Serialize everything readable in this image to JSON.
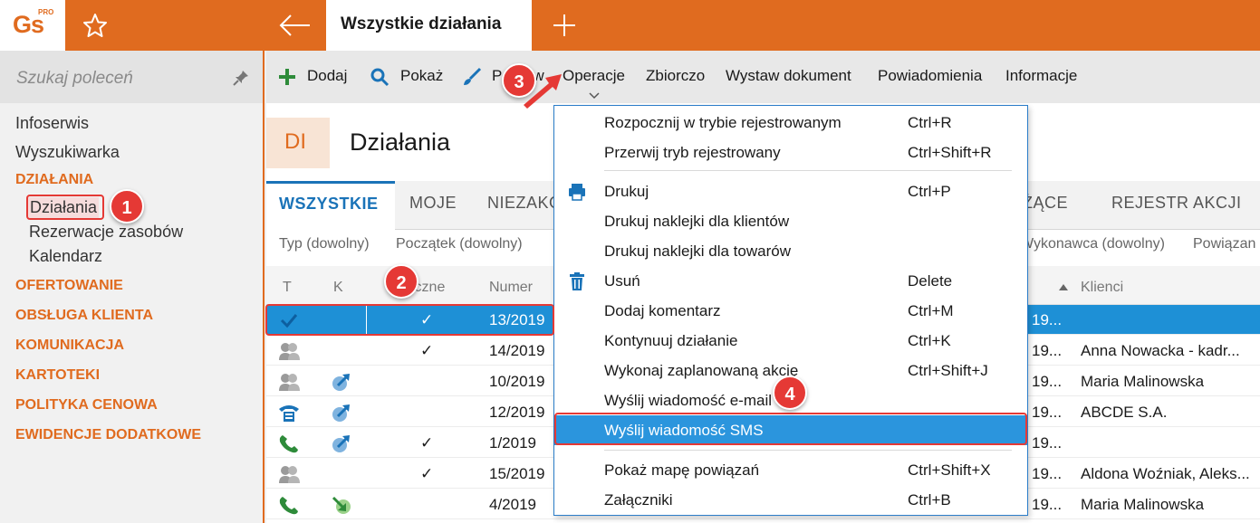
{
  "app": {
    "logo_text": "Gs",
    "logo_pro": "PRO",
    "active_tab": "Wszystkie działania",
    "accent_color": "#e06b1f",
    "selection_color": "#1e90d6"
  },
  "sidebar": {
    "search_placeholder": "Szukaj poleceń",
    "items": [
      {
        "label": "Infoserwis"
      },
      {
        "label": "Wyszukiwarka"
      }
    ],
    "section_dzialania": "DZIAŁANIA",
    "sub_items": [
      {
        "label": "Działania"
      },
      {
        "label": "Rezerwacje zasobów"
      },
      {
        "label": "Kalendarz"
      }
    ],
    "sections": [
      {
        "label": "OFERTOWANIE"
      },
      {
        "label": "OBSŁUGA KLIENTA"
      },
      {
        "label": "KOMUNIKACJA"
      },
      {
        "label": "KARTOTEKI"
      },
      {
        "label": "POLITYKA CENOWA"
      },
      {
        "label": "EWIDENCJE DODATKOWE"
      }
    ]
  },
  "toolbar": {
    "add": "Dodaj",
    "show": "Pokaż",
    "edit": "Popraw",
    "operations": "Operacje",
    "summary": "Zbiorczo",
    "issue_doc": "Wystaw dokument",
    "relations": "Powiadomienia",
    "info": "Informacje"
  },
  "page": {
    "badge": "DI",
    "title": "Działania"
  },
  "subtabs": {
    "all": "WSZYSTKIE",
    "mine": "MOJE",
    "incomplete": "NIEZAKO",
    "current": "ŻĄCE",
    "registry": "REJESTR AKCJI"
  },
  "filters": {
    "type": "Typ (dowolny)",
    "start": "Początek (dowolny)",
    "executor": "Wykonawca (dowolny)",
    "related": "Powiązan"
  },
  "columns": {
    "t": "T",
    "k": "K",
    "public": "iczne",
    "number": "Numer",
    "clients": "Klienci"
  },
  "rows": [
    {
      "number": "13/2019",
      "check": "✓",
      "date": "19...",
      "client": "",
      "type_icon": "check-icon",
      "k_icon": ""
    },
    {
      "number": "14/2019",
      "check": "✓",
      "date": "19...",
      "client": "Anna Nowacka - kadr...",
      "type_icon": "group-icon",
      "k_icon": ""
    },
    {
      "number": "10/2019",
      "check": "",
      "date": "19...",
      "client": "Maria Malinowska",
      "type_icon": "group-icon",
      "k_icon": "outgoing-arrow-icon"
    },
    {
      "number": "12/2019",
      "check": "",
      "date": "19...",
      "client": "ABCDE S.A.",
      "type_icon": "fax-icon",
      "k_icon": "outgoing-arrow-icon"
    },
    {
      "number": "1/2019",
      "check": "✓",
      "date": "19...",
      "client": "",
      "type_icon": "phone-icon",
      "k_icon": "outgoing-arrow-icon"
    },
    {
      "number": "15/2019",
      "check": "✓",
      "date": "19...",
      "client": "Aldona Woźniak, Aleks...",
      "type_icon": "group-icon",
      "k_icon": ""
    },
    {
      "number": "4/2019",
      "check": "",
      "date": "19...",
      "client": "Maria Malinowska",
      "type_icon": "phone-icon",
      "k_icon": "incoming-arrow-icon"
    }
  ],
  "menu": {
    "items": [
      {
        "label": "Rozpocznij w trybie rejestrowanym",
        "shortcut": "Ctrl+R"
      },
      {
        "label": "Przerwij tryb rejestrowany",
        "shortcut": "Ctrl+Shift+R"
      },
      {
        "label": "Drukuj",
        "shortcut": "Ctrl+P"
      },
      {
        "label": "Drukuj naklejki dla klientów",
        "shortcut": ""
      },
      {
        "label": "Drukuj naklejki dla towarów",
        "shortcut": ""
      },
      {
        "label": "Usuń",
        "shortcut": "Delete"
      },
      {
        "label": "Dodaj komentarz",
        "shortcut": "Ctrl+M"
      },
      {
        "label": "Kontynuuj działanie",
        "shortcut": "Ctrl+K"
      },
      {
        "label": "Wykonaj zaplanowaną akcję",
        "shortcut": "Ctrl+Shift+J"
      },
      {
        "label": "Wyślij wiadomość e-mail",
        "shortcut": ""
      },
      {
        "label": "Wyślij wiadomość SMS",
        "shortcut": ""
      },
      {
        "label": "Pokaż mapę powiązań",
        "shortcut": "Ctrl+Shift+X"
      },
      {
        "label": "Załączniki",
        "shortcut": "Ctrl+B"
      }
    ]
  },
  "callouts": [
    "1",
    "2",
    "3",
    "4"
  ]
}
